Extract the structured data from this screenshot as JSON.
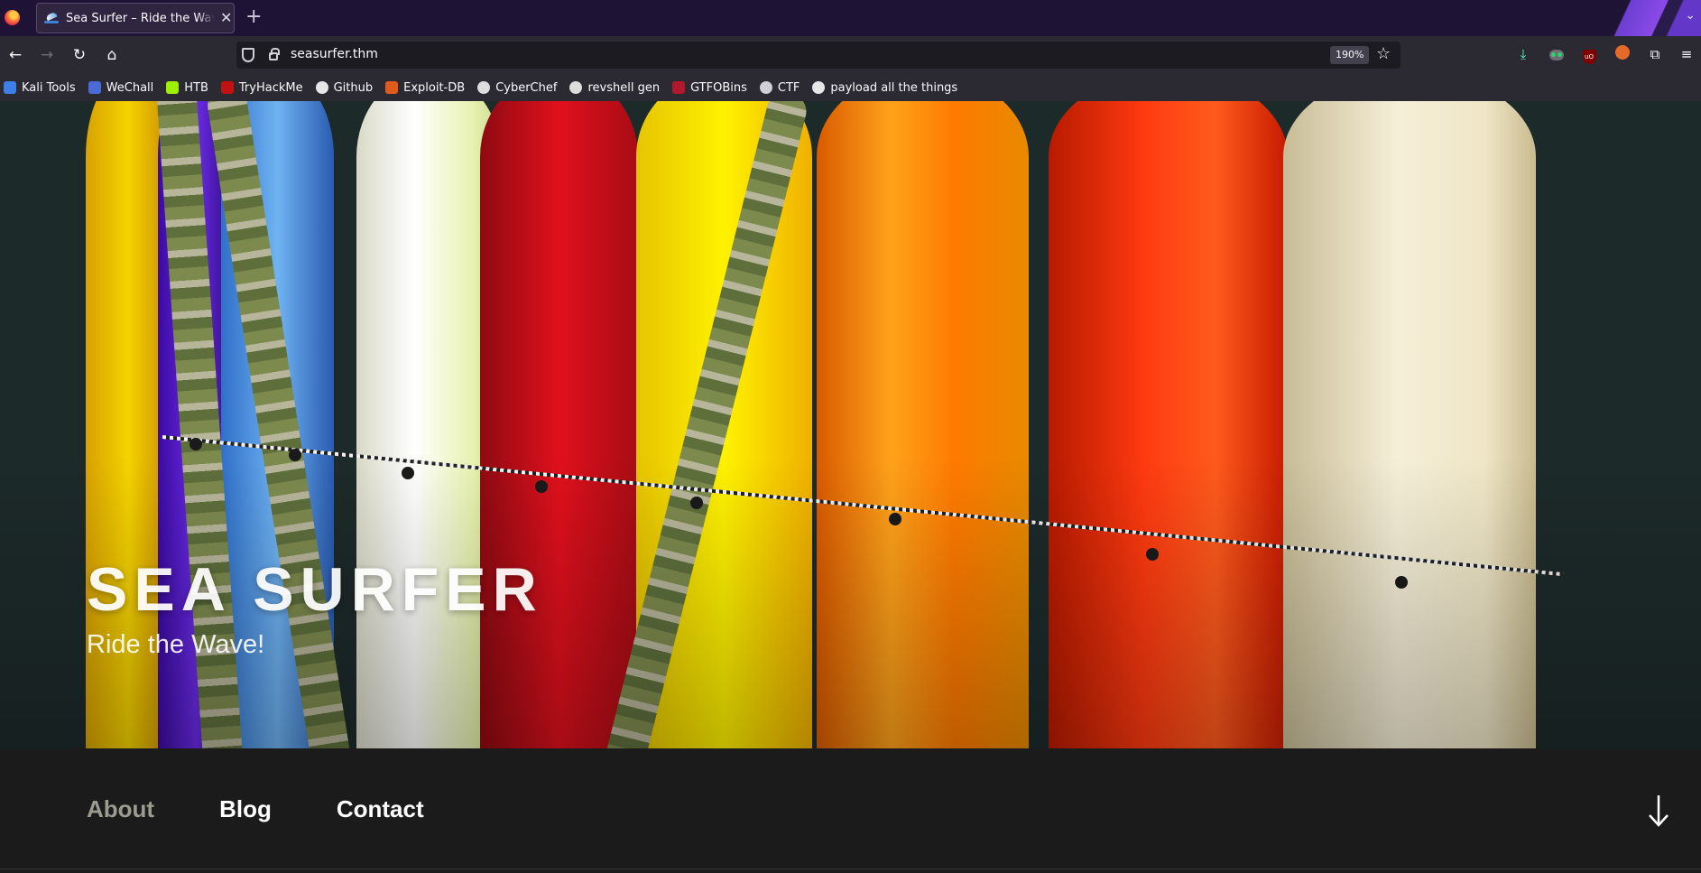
{
  "browser": {
    "tab": {
      "title": "Sea Surfer – Ride the Wave!",
      "close_icon": "close-icon"
    },
    "new_tab_label": "+",
    "url": "seasurfer.thm",
    "zoom": "190%",
    "bookmarks": [
      {
        "label": "Kali Tools",
        "icon": "kali-icon",
        "color": "#3d7fe6"
      },
      {
        "label": "WeChall",
        "icon": "wechall-icon",
        "color": "#4a6bd6"
      },
      {
        "label": "HTB",
        "icon": "htb-icon",
        "color": "#9fef00"
      },
      {
        "label": "TryHackMe",
        "icon": "tryhackme-icon",
        "color": "#c11111"
      },
      {
        "label": "Github",
        "icon": "github-icon",
        "color": "#e6e6e6"
      },
      {
        "label": "Exploit-DB",
        "icon": "exploitdb-icon",
        "color": "#e05a1c"
      },
      {
        "label": "CyberChef",
        "icon": "cyberchef-icon",
        "color": "#dddddd"
      },
      {
        "label": "revshell gen",
        "icon": "skull-icon",
        "color": "#dddddd"
      },
      {
        "label": "GTFOBins",
        "icon": "gtfobins-icon",
        "color": "#b2182b"
      },
      {
        "label": "CTF",
        "icon": "globe-icon",
        "color": "#cfcfd8"
      },
      {
        "label": "payload all the things",
        "icon": "github-icon",
        "color": "#e6e6e6"
      }
    ]
  },
  "site": {
    "title": "SEA SURFER",
    "tagline": "Ride the Wave!",
    "menu": [
      {
        "label": "About",
        "current": true
      },
      {
        "label": "Blog",
        "current": false
      },
      {
        "label": "Contact",
        "current": false
      }
    ]
  },
  "colors": {
    "tabbar_bg": "#1f1335",
    "toolbar_bg": "#2b2a33",
    "site_nav_bg": "#1b1b1b",
    "menu_current": "#9b9b8f"
  }
}
